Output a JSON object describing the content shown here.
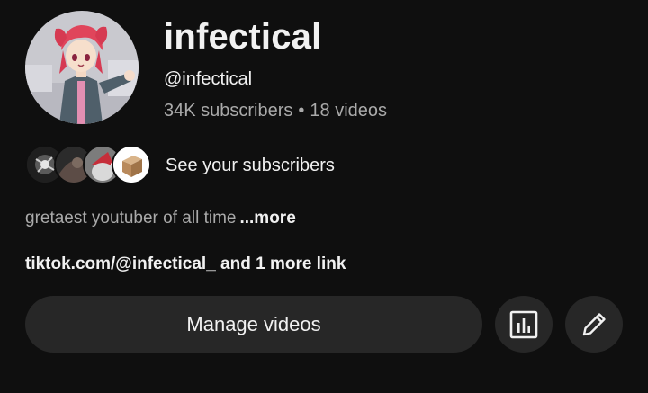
{
  "channel": {
    "name": "infectical",
    "handle": "@infectical",
    "subscribers": "34K subscribers",
    "separator": "•",
    "videos": "18 videos",
    "avatar_icon": "anime-character-avatar"
  },
  "subscribers_preview": {
    "label": "See your subscribers",
    "avatar_icons": [
      "subscriber-avatar-1",
      "subscriber-avatar-2",
      "subscriber-avatar-3",
      "subscriber-avatar-4"
    ]
  },
  "description": {
    "text": "gretaest youtuber of all time",
    "more_label": "...more"
  },
  "links": {
    "text": "tiktok.com/@infectical_ and 1 more link"
  },
  "actions": {
    "manage_videos_label": "Manage videos",
    "analytics_icon": "analytics-icon",
    "edit_icon": "pencil-icon"
  },
  "colors": {
    "background": "#0f0f0f",
    "button_bg": "#272727",
    "primary_text": "#f1f1f1",
    "secondary_text": "#aaaaaa"
  }
}
